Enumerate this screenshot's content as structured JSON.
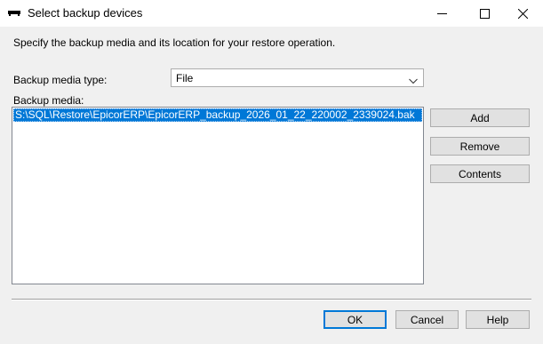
{
  "window": {
    "title": "Select backup devices",
    "minimize_icon": "minimize-icon",
    "maximize_icon": "maximize-icon",
    "close_icon": "close-icon"
  },
  "description": "Specify the backup media and its location for your restore operation.",
  "media_type": {
    "label": "Backup media type:",
    "selected": "File",
    "icon": "chevron-down-icon"
  },
  "media": {
    "label": "Backup media:",
    "items": [
      "S:\\SQL\\Restore\\EpicorERP\\EpicorERP_backup_2026_01_22_220002_2339024.bak"
    ]
  },
  "side_buttons": {
    "add": "Add",
    "remove": "Remove",
    "contents": "Contents"
  },
  "footer_buttons": {
    "ok": "OK",
    "cancel": "Cancel",
    "help": "Help"
  },
  "colors": {
    "selection": "#0078d7",
    "background": "#f0f0f0"
  }
}
